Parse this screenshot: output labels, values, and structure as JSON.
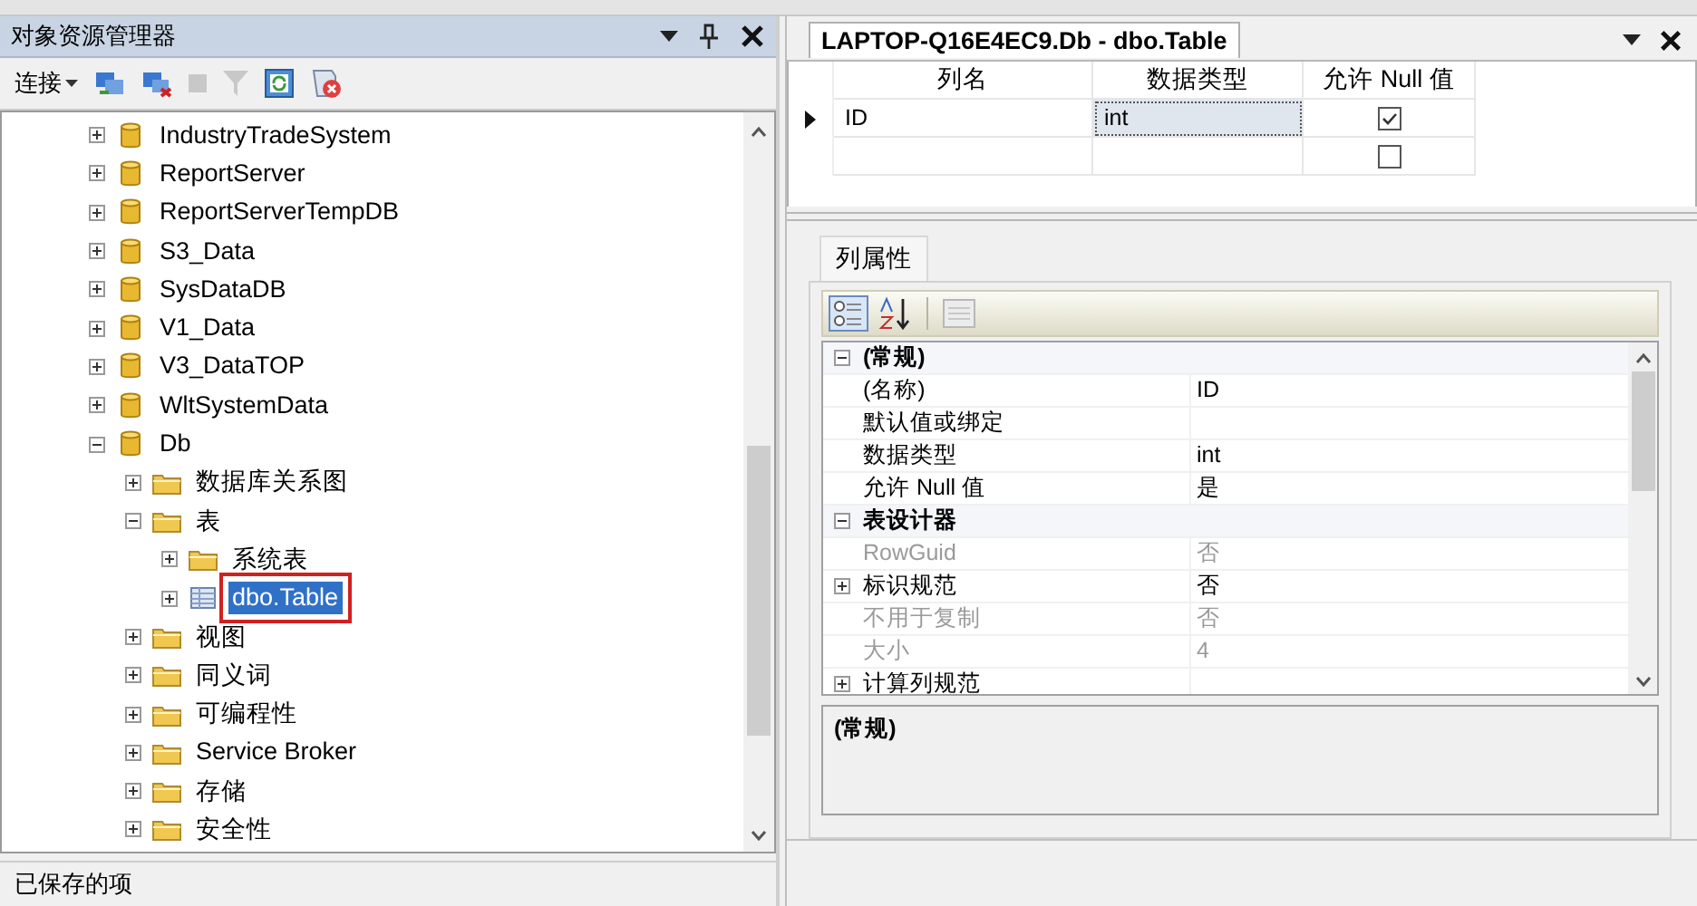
{
  "explorer": {
    "title": "对象资源管理器",
    "connect_label": "连接",
    "tree": [
      {
        "label": "IndustryTradeSystem",
        "kind": "database",
        "expanded": false,
        "selected": false
      },
      {
        "label": "ReportServer",
        "kind": "database",
        "expanded": false,
        "selected": false
      },
      {
        "label": "ReportServerTempDB",
        "kind": "database",
        "expanded": false,
        "selected": false
      },
      {
        "label": "S3_Data",
        "kind": "database",
        "expanded": false,
        "selected": false
      },
      {
        "label": "SysDataDB",
        "kind": "database",
        "expanded": false,
        "selected": false
      },
      {
        "label": "V1_Data",
        "kind": "database",
        "expanded": false,
        "selected": false
      },
      {
        "label": "V3_DataTOP",
        "kind": "database",
        "expanded": false,
        "selected": false
      },
      {
        "label": "WltSystemData",
        "kind": "database",
        "expanded": false,
        "selected": false
      },
      {
        "label": "Db",
        "kind": "database",
        "expanded": true,
        "selected": false,
        "children": [
          {
            "label": "数据库关系图",
            "kind": "folder",
            "expanded": false,
            "selected": false
          },
          {
            "label": "表",
            "kind": "folder",
            "expanded": true,
            "selected": false,
            "children": [
              {
                "label": "系统表",
                "kind": "folder",
                "expanded": false,
                "selected": false
              },
              {
                "label": "dbo.Table",
                "kind": "table",
                "expanded": false,
                "selected": true
              }
            ]
          },
          {
            "label": "视图",
            "kind": "folder",
            "expanded": false,
            "selected": false
          },
          {
            "label": "同义词",
            "kind": "folder",
            "expanded": false,
            "selected": false
          },
          {
            "label": "可编程性",
            "kind": "folder",
            "expanded": false,
            "selected": false
          },
          {
            "label": "Service Broker",
            "kind": "folder",
            "expanded": false,
            "selected": false
          },
          {
            "label": "存储",
            "kind": "folder",
            "expanded": false,
            "selected": false
          },
          {
            "label": "安全性",
            "kind": "folder",
            "expanded": false,
            "selected": false
          }
        ]
      }
    ]
  },
  "status_bar": "已保存的项",
  "designer": {
    "tab_title": "LAPTOP-Q16E4EC9.Db - dbo.Table",
    "columns": [
      "列名",
      "数据类型",
      "允许 Null 值"
    ],
    "rows": [
      {
        "name": "ID",
        "type": "int",
        "allow_null": true,
        "current": true
      },
      {
        "allow_null": false,
        "current": false
      }
    ]
  },
  "properties": {
    "tab": "列属性",
    "rows": [
      {
        "kind": "category",
        "name": "(常规)",
        "expanded": true
      },
      {
        "kind": "property",
        "name": "(名称)",
        "value": "ID",
        "disabled": false
      },
      {
        "kind": "property",
        "name": "默认值或绑定",
        "disabled": false
      },
      {
        "kind": "property",
        "name": "数据类型",
        "value": "int",
        "disabled": false
      },
      {
        "kind": "property",
        "name": "允许 Null 值",
        "value": "是",
        "disabled": false
      },
      {
        "kind": "category",
        "name": "表设计器",
        "expanded": true
      },
      {
        "kind": "property",
        "name": "RowGuid",
        "value": "否",
        "disabled": true
      },
      {
        "kind": "group",
        "name": "标识规范",
        "value": "否",
        "disabled": false,
        "expanded": false
      },
      {
        "kind": "property",
        "name": "不用于复制",
        "value": "否",
        "disabled": true
      },
      {
        "kind": "property",
        "name": "大小",
        "value": "4",
        "disabled": true
      },
      {
        "kind": "group",
        "name": "计算列规范",
        "disabled": false,
        "expanded": false
      }
    ],
    "description": "(常规)"
  }
}
